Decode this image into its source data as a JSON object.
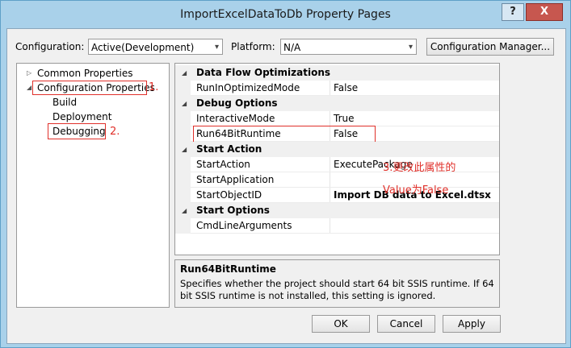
{
  "window": {
    "title": "ImportExcelDataToDb Property Pages",
    "help_glyph": "?",
    "close_glyph": "X"
  },
  "toolbar": {
    "configuration_label": "Configuration:",
    "configuration_value": "Active(Development)",
    "platform_label": "Platform:",
    "platform_value": "N/A",
    "config_manager_label": "Configuration Manager..."
  },
  "tree": {
    "common": "Common Properties",
    "config": "Configuration Properties",
    "build": "Build",
    "deployment": "Deployment",
    "debugging": "Debugging"
  },
  "annotations": {
    "a1": "1.",
    "a2": "2.",
    "a3_line1": "3.更改此属性的",
    "a3_line2": "Value为False"
  },
  "grid": {
    "cat_dataflow": "Data Flow Optimizations",
    "run_opt_name": "RunInOptimizedMode",
    "run_opt_value": "False",
    "cat_debug": "Debug Options",
    "interactive_name": "InteractiveMode",
    "interactive_value": "True",
    "run64_name": "Run64BitRuntime",
    "run64_value": "False",
    "cat_start_action": "Start Action",
    "start_action_name": "StartAction",
    "start_action_value": "ExecutePackage",
    "start_app_name": "StartApplication",
    "start_app_value": "",
    "start_obj_name": "StartObjectID",
    "start_obj_value": "Import DB data to Excel.dtsx",
    "cat_start_options": "Start Options",
    "cmd_args_name": "CmdLineArguments",
    "cmd_args_value": ""
  },
  "description": {
    "title": "Run64BitRuntime",
    "text": "Specifies whether the project should start 64 bit SSIS runtime. If 64 bit SSIS runtime is not installed, this setting is ignored."
  },
  "buttons": {
    "ok": "OK",
    "cancel": "Cancel",
    "apply": "Apply"
  },
  "icons": {
    "collapsed": "▷",
    "expanded": "◢",
    "dropdown": "▾"
  }
}
